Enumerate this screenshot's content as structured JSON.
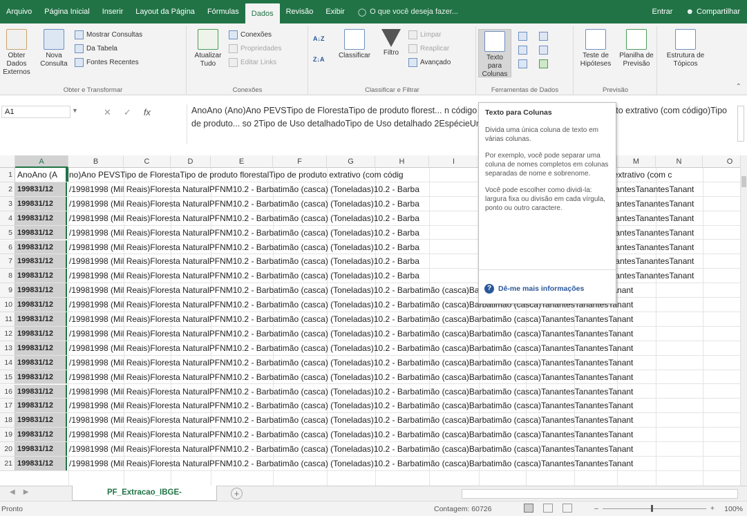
{
  "menubar": {
    "tabs": [
      "Arquivo",
      "Página Inicial",
      "Inserir",
      "Layout da Página",
      "Fórmulas",
      "Dados",
      "Revisão",
      "Exibir"
    ],
    "active_tab": "Dados",
    "tell_me": "O que você deseja fazer...",
    "signin": "Entrar",
    "share": "Compartilhar"
  },
  "ribbon": {
    "ext_data": "Obter Dados Externos",
    "nova_consulta": "Nova Consulta",
    "mostrar_consultas": "Mostrar Consultas",
    "da_tabela": "Da Tabela",
    "fontes_recentes": "Fontes Recentes",
    "g_obter": "Obter e Transformar",
    "atualizar": "Atualizar Tudo",
    "conexoes": "Conexões",
    "propriedades": "Propriedades",
    "editar_links": "Editar Links",
    "g_conexoes": "Conexões",
    "classificar": "Classificar",
    "filtro": "Filtro",
    "limpar": "Limpar",
    "reaplicar": "Reaplicar",
    "avancado": "Avançado",
    "g_classificar": "Classificar e Filtrar",
    "texto_colunas": "Texto para Colunas",
    "g_ferramentas": "Ferramentas de Dados",
    "teste_hipoteses": "Teste de Hipóteses",
    "planilha_previsao": "Planilha de Previsão",
    "g_previsao": "Previsão",
    "estrutura_topicos": "Estrutura de Tópicos"
  },
  "formula_bar": {
    "name_box": "A1",
    "fx": "fx",
    "content": "AnoAno (Ano)Ano PEVSTipo de FlorestaTipo de produto florest... n código e unidade de medida)Tipo de produto extrativo (com código)Tipo de produto... so 2Tipo de Uso detalhadoTipo de Uso detalhado 2EspécieUnidade da Federação... tidade"
  },
  "grid": {
    "columns": [
      "A",
      "B",
      "C",
      "D",
      "E",
      "F",
      "G",
      "H",
      "I",
      "J",
      "K",
      "L",
      "M",
      "N",
      "O"
    ],
    "row_numbers": [
      "1",
      "2",
      "3",
      "4",
      "5",
      "6",
      "7",
      "8",
      "9",
      "10",
      "11",
      "12",
      "13",
      "14",
      "15",
      "16",
      "17",
      "18",
      "19",
      "20",
      "21"
    ],
    "row1_a": "AnoAno (A",
    "row1_rest": "no)Ano PEVSTipo de FlorestaTipo de produto florestalTipo de produto extrativo (com códig                                                                              produto extrativo (com c",
    "data_a": "199831/12",
    "data_rest_partial": "/19981998 (Mil Reais)Floresta NaturalPFNM10.2 - Barbatimão (casca) (Toneladas)10.2 - Barba                                                                              )TanantesTanantesTanant",
    "data_rest_full": "/19981998 (Mil Reais)Floresta NaturalPFNM10.2 - Barbatimão (casca) (Toneladas)10.2 - Barbatimão (casca)Barbatimão (casca)TanantesTanantesTanant"
  },
  "tooltip": {
    "title": "Texto para Colunas",
    "p1": "Divida uma única coluna de texto em várias colunas.",
    "p2": "Por exemplo, você pode separar uma coluna de nomes completos em colunas separadas de nome e sobrenome.",
    "p3": "Você pode escolher como dividi-la: largura fixa ou divisão em cada vírgula, ponto ou outro caractere.",
    "more": "Dê-me mais informações"
  },
  "sheets": {
    "active": "PF_Extracao_IBGE-PEVS_SIDRA_UF_",
    "add": "+"
  },
  "status": {
    "ready": "Pronto",
    "count": "Contagem: 60726",
    "zoom": "100%"
  },
  "colors": {
    "excel_green": "#217346",
    "link_blue": "#2b579a"
  }
}
